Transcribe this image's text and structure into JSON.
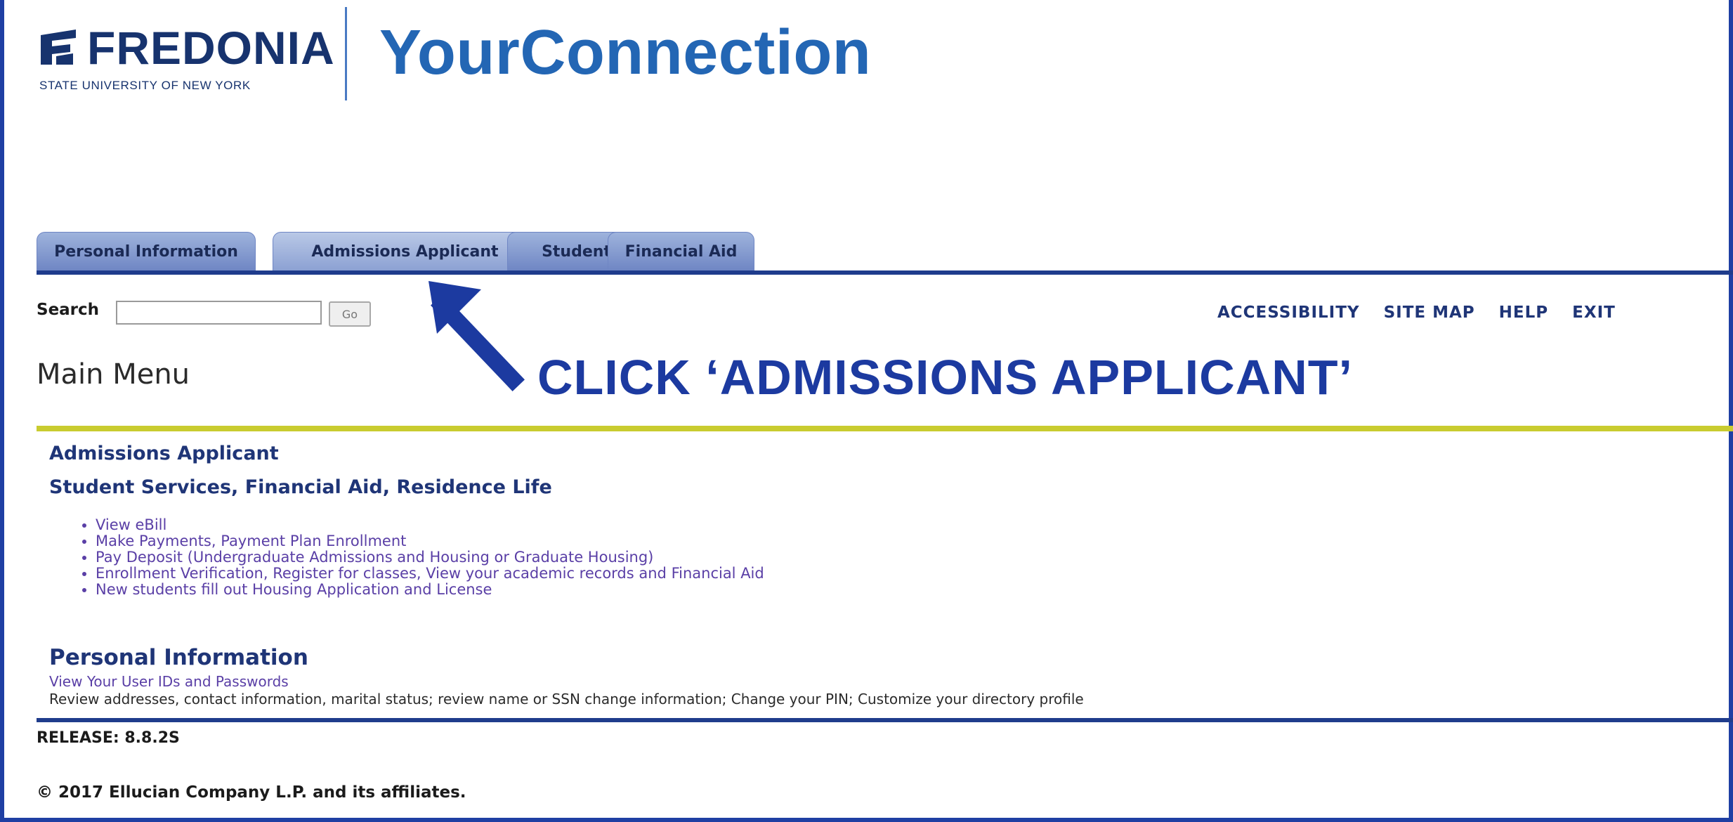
{
  "header": {
    "logo_word": "FREDONIA",
    "logo_sub": "STATE UNIVERSITY OF NEW YORK",
    "app_title": "YourConnection"
  },
  "tabs": [
    {
      "label": "Personal Information",
      "active": false
    },
    {
      "label": "Admissions Applicant",
      "active": true
    },
    {
      "label": "Student",
      "active": false
    },
    {
      "label": "Financial Aid",
      "active": false
    }
  ],
  "search": {
    "label": "Search",
    "value": "",
    "button": "Go"
  },
  "nav": {
    "accessibility": "ACCESSIBILITY",
    "site_map": "SITE MAP",
    "help": "HELP",
    "exit": "EXIT"
  },
  "page_title": "Main Menu",
  "annotation": {
    "text": "CLICK ‘ADMISSIONS APPLICANT’",
    "arrow_icon": "arrow-up-left-icon"
  },
  "menu": {
    "admissions_heading": "Admissions Applicant",
    "services_heading": "Student Services, Financial Aid, Residence Life",
    "services_items": [
      "View eBill",
      "Make Payments, Payment Plan Enrollment",
      "Pay Deposit (Undergraduate Admissions and Housing or Graduate Housing)",
      "Enrollment Verification, Register for classes, View your academic records and Financial Aid",
      "New students fill out Housing Application and License"
    ],
    "personal_heading": "Personal Information",
    "personal_link": "View Your User IDs and Passwords",
    "personal_desc": "Review addresses, contact information, marital status; review name or SSN change information; Change your PIN; Customize your directory profile"
  },
  "footer": {
    "release": "RELEASE: 8.8.2S",
    "copyright": "© 2017 Ellucian Company L.P. and its affiliates."
  },
  "colors": {
    "brand_navy": "#17336e",
    "title_blue": "#2366b4",
    "tab_line": "#1f3c8c",
    "accent_yellow": "#c9cc2f",
    "annotation_blue": "#1c3aa0",
    "link_purple": "#5a3fa6"
  }
}
